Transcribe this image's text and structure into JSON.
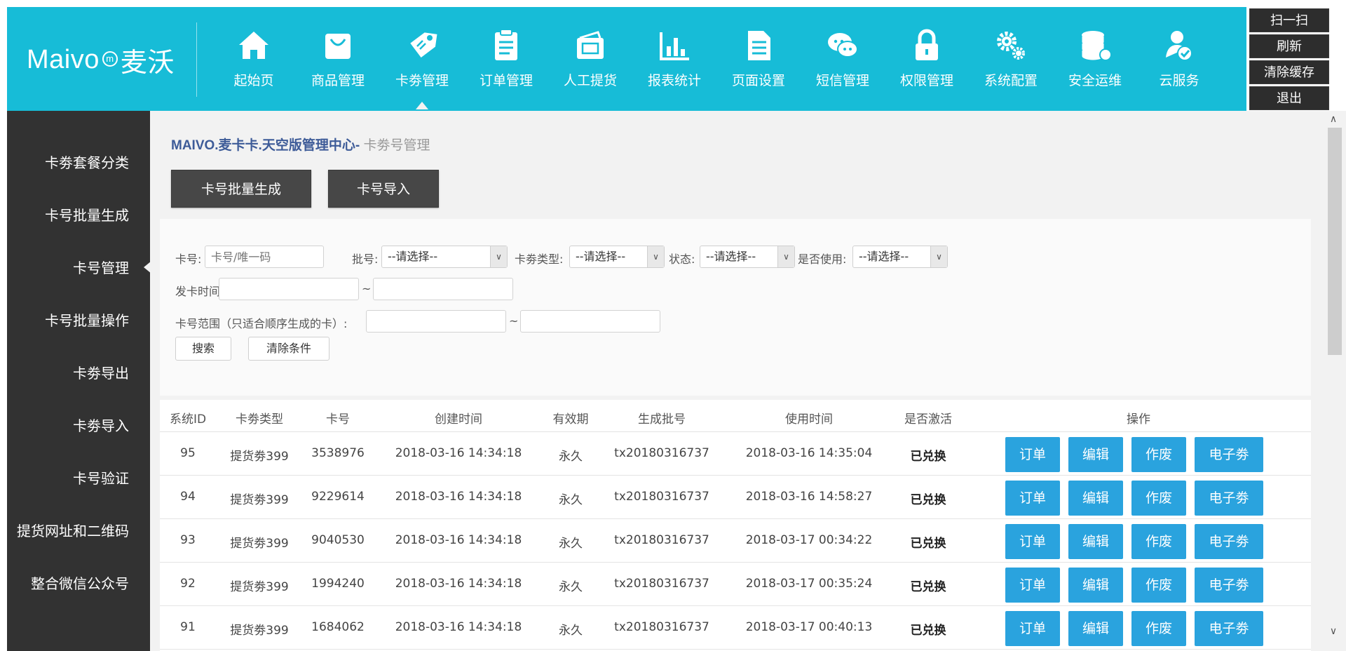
{
  "brand": {
    "name_latin": "Maivo",
    "mark": "m",
    "name_cn": "麦沃"
  },
  "nav": [
    {
      "label": "起始页",
      "icon": "home-icon"
    },
    {
      "label": "商品管理",
      "icon": "shopping-bag-icon"
    },
    {
      "label": "卡劵管理",
      "icon": "tag-icon",
      "active": true
    },
    {
      "label": "订单管理",
      "icon": "clipboard-icon"
    },
    {
      "label": "人工提货",
      "icon": "wallet-icon"
    },
    {
      "label": "报表统计",
      "icon": "bar-chart-icon"
    },
    {
      "label": "页面设置",
      "icon": "document-icon"
    },
    {
      "label": "短信管理",
      "icon": "chat-icon"
    },
    {
      "label": "权限管理",
      "icon": "lock-icon"
    },
    {
      "label": "系统配置",
      "icon": "gears-icon"
    },
    {
      "label": "安全运维",
      "icon": "database-icon"
    },
    {
      "label": "云服务",
      "icon": "user-check-icon"
    }
  ],
  "quick_actions": [
    "扫一扫",
    "刷新",
    "清除缓存",
    "退出"
  ],
  "sidebar": [
    {
      "label": "卡劵套餐分类"
    },
    {
      "label": "卡号批量生成"
    },
    {
      "label": "卡号管理",
      "active": true
    },
    {
      "label": "卡号批量操作"
    },
    {
      "label": "卡劵导出"
    },
    {
      "label": "卡劵导入"
    },
    {
      "label": "卡号验证"
    },
    {
      "label": "提货网址和二维码"
    },
    {
      "label": "整合微信公众号"
    }
  ],
  "breadcrumb": {
    "site": "MAIVO.麦卡卡.天空版管理中心",
    "separator": "- ",
    "page": "卡劵号管理"
  },
  "actions": {
    "batch_generate": "卡号批量生成",
    "import": "卡号导入"
  },
  "filters": {
    "card_no_label": "卡号:",
    "card_no_placeholder": "卡号/唯一码",
    "batch_label": "批号:",
    "batch_value": "--请选择--",
    "type_label": "卡劵类型:",
    "type_value": "--请选择--",
    "status_label": "状态:",
    "status_value": "--请选择--",
    "used_label": "是否使用:",
    "used_value": "--请选择--",
    "issue_time_label": "发卡时间:",
    "range_sep": "~",
    "range_label": "卡号范围（只适合顺序生成的卡）:",
    "search_button": "搜索",
    "clear_button": "清除条件"
  },
  "table": {
    "columns": [
      "系统ID",
      "卡劵类型",
      "卡号",
      "创建时间",
      "有效期",
      "生成批号",
      "使用时间",
      "是否激活",
      "操作"
    ],
    "rows": [
      [
        "95",
        "提货劵399",
        "3538976",
        "2018-03-16 14:34:18",
        "永久",
        "tx20180316737",
        "2018-03-16 14:35:04",
        "已兑换"
      ],
      [
        "94",
        "提货劵399",
        "9229614",
        "2018-03-16 14:34:18",
        "永久",
        "tx20180316737",
        "2018-03-16 14:58:27",
        "已兑换"
      ],
      [
        "93",
        "提货劵399",
        "9040530",
        "2018-03-16 14:34:18",
        "永久",
        "tx20180316737",
        "2018-03-17 00:34:22",
        "已兑换"
      ],
      [
        "92",
        "提货劵399",
        "1994240",
        "2018-03-16 14:34:18",
        "永久",
        "tx20180316737",
        "2018-03-17 00:35:24",
        "已兑换"
      ],
      [
        "91",
        "提货劵399",
        "1684062",
        "2018-03-16 14:34:18",
        "永久",
        "tx20180316737",
        "2018-03-17 00:40:13",
        "已兑换"
      ]
    ],
    "row_actions": [
      "订单",
      "编辑",
      "作废",
      "电子劵"
    ]
  },
  "colors": {
    "topbar": "#17bcd7",
    "sidebar": "#323232",
    "content_bg": "#f2f2f2",
    "action_button": "#474747",
    "row_button": "#2aa3de",
    "breadcrumb_site": "#3d5b98"
  }
}
